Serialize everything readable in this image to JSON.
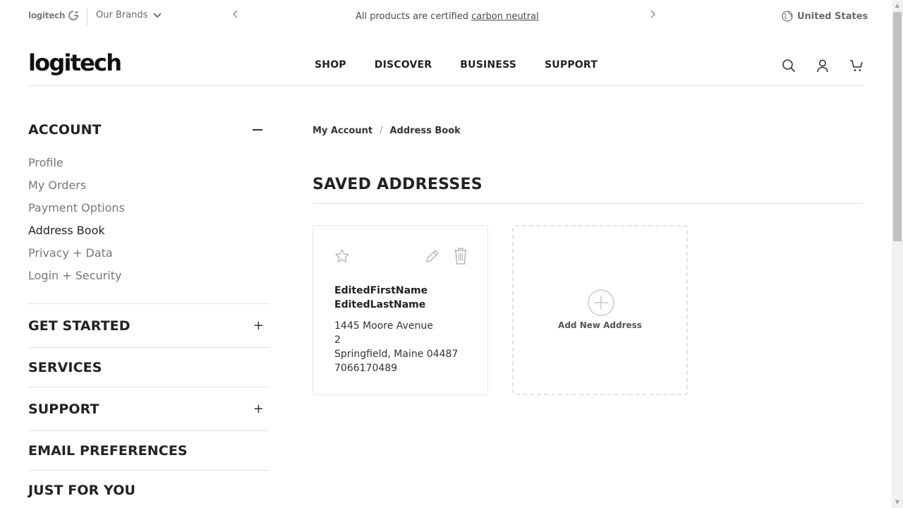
{
  "promo": {
    "brand_mini": "logitech",
    "our_brands": "Our Brands",
    "message_prefix": "All products are certified",
    "message_link": "carbon neutral",
    "country": "United States"
  },
  "header": {
    "logo": "logitech",
    "nav": [
      "SHOP",
      "DISCOVER",
      "BUSINESS",
      "SUPPORT"
    ]
  },
  "sidebar": {
    "account_title": "ACCOUNT",
    "links": [
      "Profile",
      "My Orders",
      "Payment Options",
      "Address Book",
      "Privacy + Data",
      "Login + Security"
    ],
    "active_link": "Address Book",
    "sections": {
      "get_started": "GET STARTED",
      "services": "SERVICES",
      "support": "SUPPORT",
      "email_preferences": "EMAIL PREFERENCES",
      "just_for_you": "JUST FOR YOU"
    }
  },
  "breadcrumb": {
    "root": "My Account",
    "current": "Address Book"
  },
  "main": {
    "title": "SAVED ADDRESSES",
    "address_card": {
      "first_name": "EditedFirstName",
      "last_name": "EditedLastName",
      "street": "1445 Moore Avenue",
      "unit": "2",
      "city_state_zip": "Springfield, Maine 04487",
      "phone": "7066170489"
    },
    "add_new_label": "Add New Address"
  },
  "colors": {
    "text_dark": "#222222",
    "text_muted": "#777777",
    "border": "#e6e6e6",
    "icon_gray": "#b5b5b5"
  }
}
